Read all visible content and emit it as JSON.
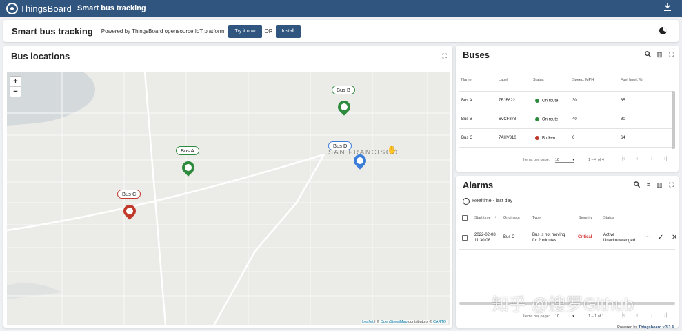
{
  "topbar": {
    "logo_text": "ThingsBoard",
    "dashboard_title": "Smart bus tracking",
    "download_icon": "download-icon"
  },
  "header": {
    "title": "Smart bus tracking",
    "powered_text": "Powered by ThingsBoard opensource IoT platform.",
    "try_label": "Try it now",
    "or_label": "OR",
    "install_label": "Install",
    "theme_icon": "dark-mode-icon"
  },
  "map_card": {
    "title": "Bus locations",
    "zoom_in": "+",
    "zoom_out": "−",
    "city_label": "SAN FRANCISCO",
    "markers": [
      {
        "label": "Bus B",
        "color": "#2e8b3e"
      },
      {
        "label": "Bus A",
        "color": "#2e8b3e"
      },
      {
        "label": "Bus D",
        "color": "#3b7dd8"
      },
      {
        "label": "Bus C",
        "color": "#c0392b"
      }
    ],
    "attribution": {
      "leaflet": "Leaflet",
      "sep1": " | © ",
      "osm": "OpenStreetMap",
      "mid": " contributors © ",
      "carto": "CARTO"
    }
  },
  "buses": {
    "title": "Buses",
    "columns": [
      "Name",
      "Label",
      "Status",
      "Speed, MPH",
      "Fuel level, %"
    ],
    "rows": [
      {
        "name": "Bus A",
        "label": "7BJF622",
        "status": "On route",
        "status_color": "#2e8b3e",
        "speed": "30",
        "fuel": "35"
      },
      {
        "name": "Bus B",
        "label": "6VCF878",
        "status": "On route",
        "status_color": "#2e8b3e",
        "speed": "40",
        "fuel": "80"
      },
      {
        "name": "Bus C",
        "label": "7AHV310",
        "status": "Broken",
        "status_color": "#c0392b",
        "speed": "0",
        "fuel": "64"
      }
    ],
    "items_per_page_label": "Items per page:",
    "items_per_page": "10",
    "range": "1 – 4 of 4"
  },
  "alarms": {
    "title": "Alarms",
    "realtime": "Realtime - last day",
    "columns": [
      "Start time",
      "Originator",
      "Type",
      "Severity",
      "Status"
    ],
    "rows": [
      {
        "start_date": "2022-02-08",
        "start_time": "11:30:08",
        "originator": "Bus C",
        "type_line1": "Bus is not moving",
        "type_line2": "for 2 minutes",
        "severity": "Critical",
        "severity_color": "#d32f2f",
        "status_line1": "Active",
        "status_line2": "Unacknowledged"
      }
    ],
    "items_per_page_label": "Items per page:",
    "items_per_page": "10",
    "range": "1 – 1 of 1"
  },
  "footer": {
    "powered": "Powered by ",
    "link": "Thingsboard v.3.3.4"
  },
  "watermark": "知乎 @搜罗Github"
}
